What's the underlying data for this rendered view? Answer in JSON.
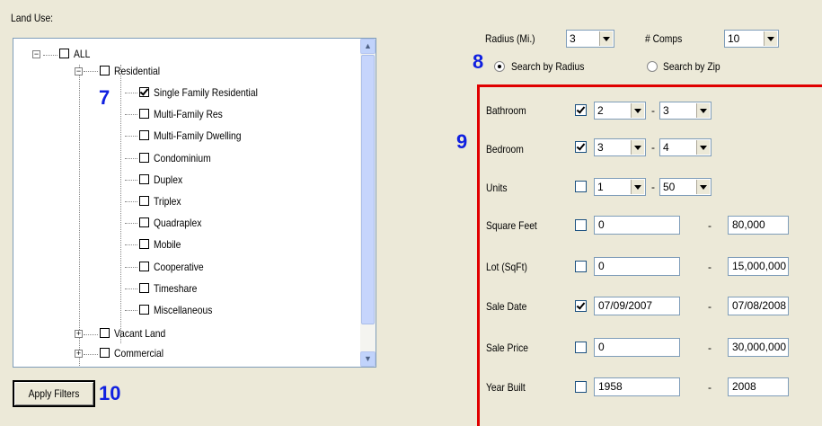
{
  "land_use": {
    "label": "Land Use:",
    "tree": {
      "root": {
        "label": "ALL",
        "checked": false
      },
      "residential": {
        "label": "Residential",
        "checked": false
      },
      "residential_children": [
        {
          "label": "Single Family Residential",
          "checked": true
        },
        {
          "label": "Multi-Family Res",
          "checked": false
        },
        {
          "label": "Multi-Family Dwelling",
          "checked": false
        },
        {
          "label": "Condominium",
          "checked": false
        },
        {
          "label": "Duplex",
          "checked": false
        },
        {
          "label": "Triplex",
          "checked": false
        },
        {
          "label": "Quadraplex",
          "checked": false
        },
        {
          "label": "Mobile",
          "checked": false
        },
        {
          "label": "Cooperative",
          "checked": false
        },
        {
          "label": "Timeshare",
          "checked": false
        },
        {
          "label": "Miscellaneous",
          "checked": false
        }
      ],
      "vacant_land": {
        "label": "Vacant Land",
        "checked": false
      },
      "commercial": {
        "label": "Commercial",
        "checked": false
      }
    }
  },
  "apply_button": "Apply Filters",
  "markers": {
    "m7": "7",
    "m8": "8",
    "m9": "9",
    "m10": "10"
  },
  "search": {
    "radius_label": "Radius (Mi.)",
    "radius_value": "3",
    "comps_label": "# Comps",
    "comps_value": "10",
    "by_radius_label": "Search by Radius",
    "by_zip_label": "Search by Zip",
    "selected": "radius"
  },
  "filters": {
    "bathroom": {
      "label": "Bathroom",
      "checked": true,
      "from": "2",
      "to": "3"
    },
    "bedroom": {
      "label": "Bedroom",
      "checked": true,
      "from": "3",
      "to": "4"
    },
    "units": {
      "label": "Units",
      "checked": false,
      "from": "1",
      "to": "50"
    },
    "square_feet": {
      "label": "Square Feet",
      "checked": false,
      "from": "0",
      "to": "80,000"
    },
    "lot": {
      "label": "Lot (SqFt)",
      "checked": false,
      "from": "0",
      "to": "15,000,000"
    },
    "sale_date": {
      "label": "Sale Date",
      "checked": true,
      "from": "07/09/2007",
      "to": "07/08/2008"
    },
    "sale_price": {
      "label": "Sale Price",
      "checked": false,
      "from": "0",
      "to": "30,000,000"
    },
    "year_built": {
      "label": "Year Built",
      "checked": false,
      "from": "1958",
      "to": "2008"
    }
  },
  "separator": "-",
  "colors": {
    "marker": "#1020e0",
    "highlight_frame": "#e00000",
    "background": "#ece9d8"
  }
}
